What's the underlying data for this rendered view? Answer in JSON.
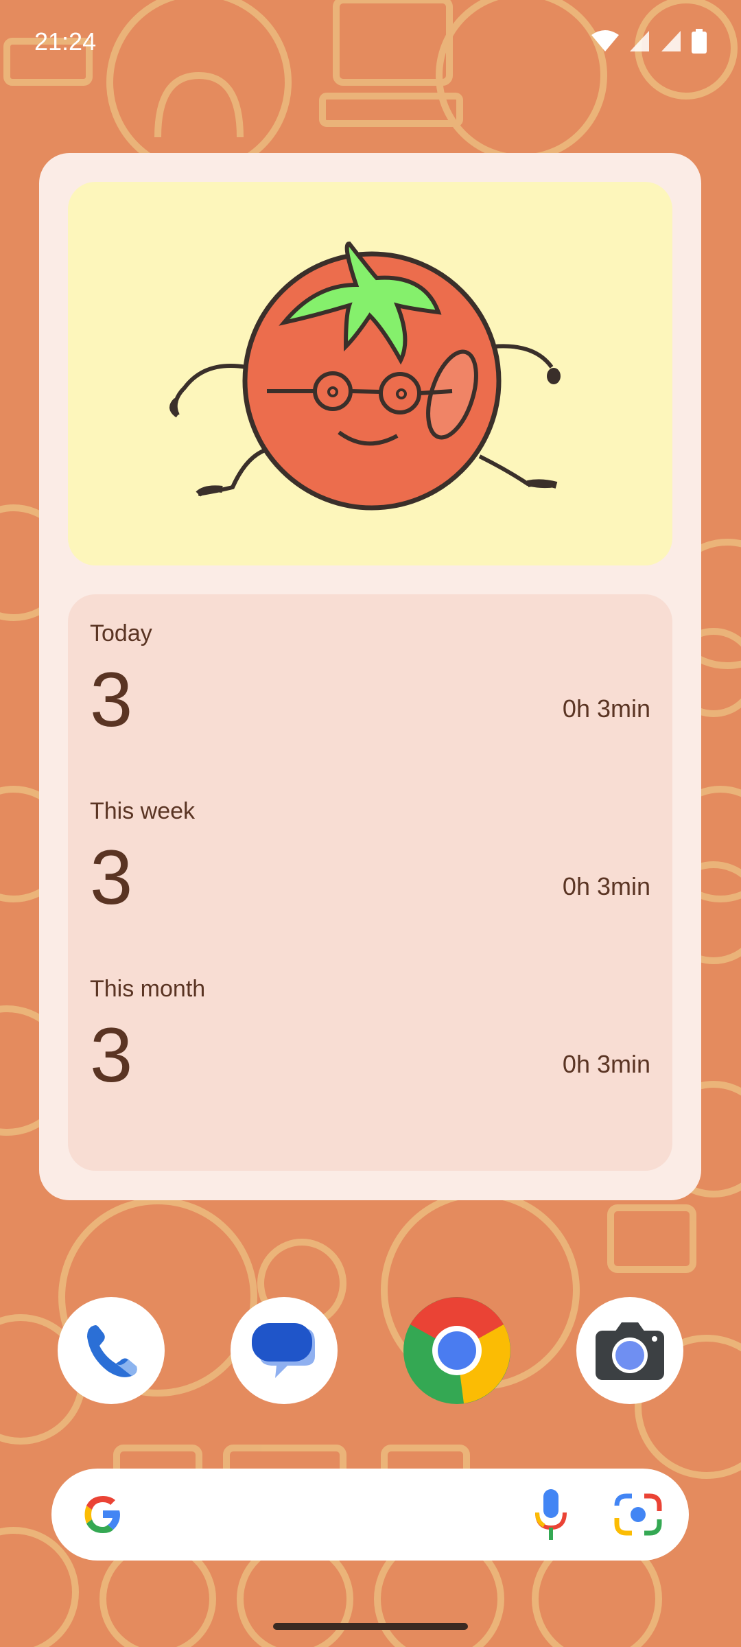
{
  "status_bar": {
    "time": "21:24",
    "icons": [
      "wifi-icon",
      "signal-icon",
      "signal-icon",
      "battery-icon"
    ]
  },
  "widget": {
    "illustration": "tomato-character-icon",
    "stats": [
      {
        "label": "Today",
        "count": "3",
        "duration": "0h 3min"
      },
      {
        "label": "This week",
        "count": "3",
        "duration": "0h 3min"
      },
      {
        "label": "This month",
        "count": "3",
        "duration": "0h 3min"
      }
    ]
  },
  "dock": {
    "apps": [
      "phone-icon",
      "messages-icon",
      "chrome-icon",
      "camera-icon"
    ]
  },
  "search_bar": {
    "icons": [
      "google-icon",
      "microphone-icon",
      "lens-icon"
    ]
  },
  "colors": {
    "wallpaper": "#e48b5e",
    "wallpaper_pattern": "#ebb87c",
    "widget_bg": "#fbece6",
    "art_bg": "#fdf6bb",
    "stats_bg": "#f8ddd3",
    "text": "#5a3423"
  }
}
